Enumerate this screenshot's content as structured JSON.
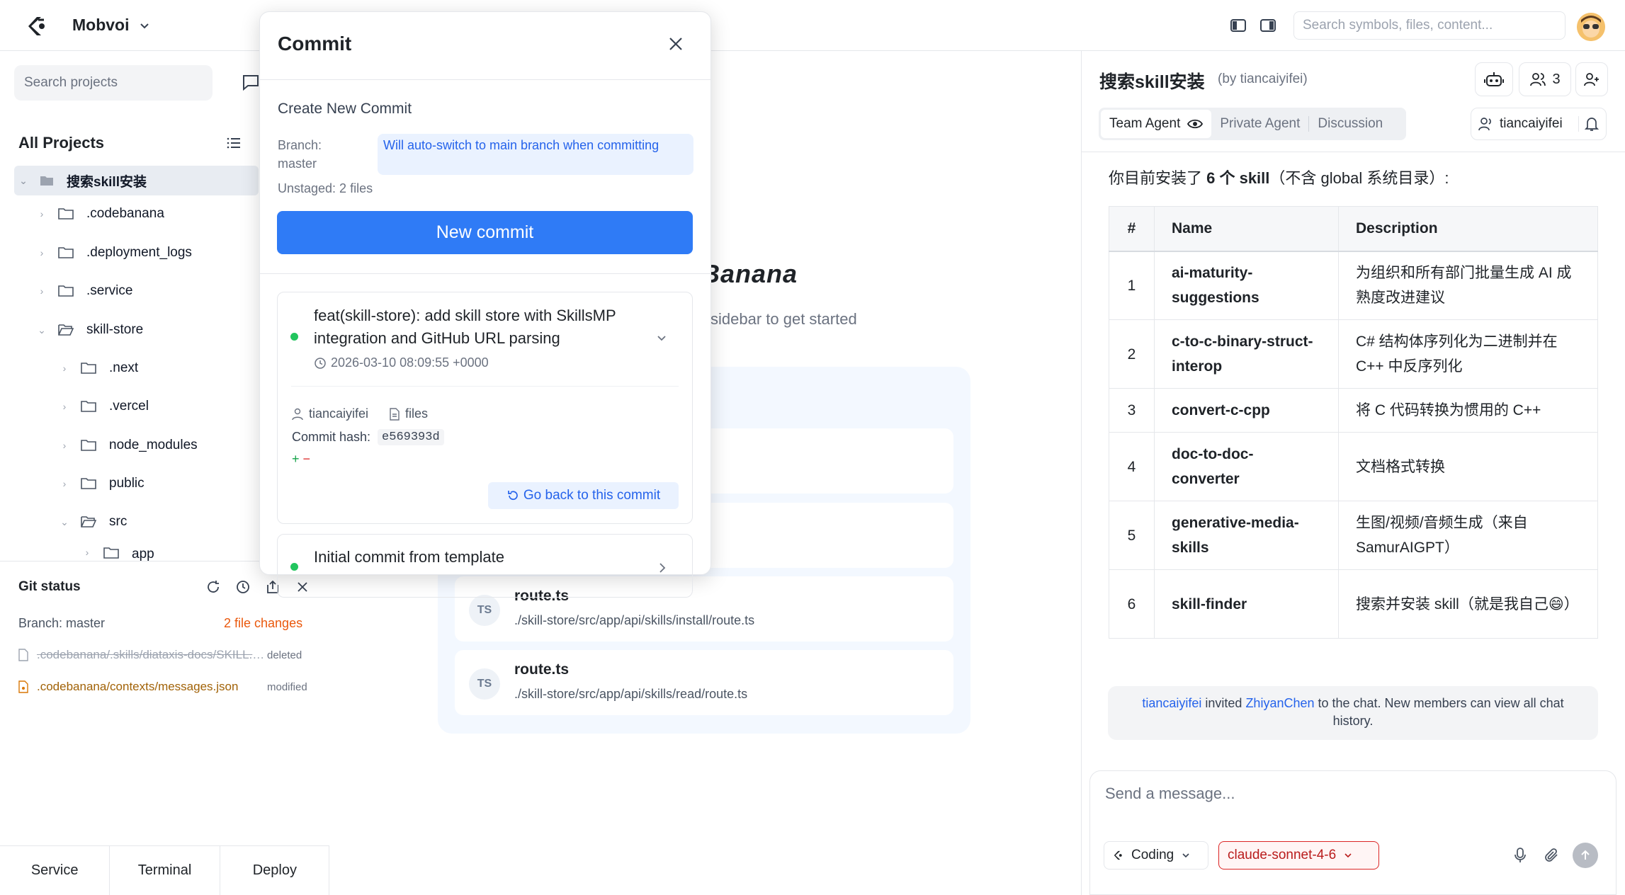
{
  "header": {
    "org_name": "Mobvoi",
    "search_placeholder": "Search symbols, files, content..."
  },
  "sidebar": {
    "search_placeholder": "Search projects",
    "section_title": "All Projects",
    "tree": {
      "root": "搜索skill安装",
      "items": [
        {
          "label": ".codebanana"
        },
        {
          "label": ".deployment_logs"
        },
        {
          "label": ".service"
        },
        {
          "label": "skill-store"
        },
        {
          "label": ".next"
        },
        {
          "label": ".vercel"
        },
        {
          "label": "node_modules"
        },
        {
          "label": "public"
        },
        {
          "label": "src"
        },
        {
          "label": "app"
        }
      ]
    }
  },
  "git_status": {
    "title": "Git status",
    "branch": "Branch: master",
    "changes": "2 file changes",
    "files": [
      {
        "name": ".codebanana/.skills/diataxis-docs/SKILL.md",
        "status": "deleted"
      },
      {
        "name": ".codebanana/contexts/messages.json",
        "status": "modified"
      }
    ]
  },
  "bottom_tabs": [
    "Service",
    "Terminal",
    "Deploy"
  ],
  "welcome": {
    "title_partial": "Banana",
    "subtitle_partial": "sidebar to get started"
  },
  "recent_files": [
    {
      "badge": "TS",
      "name": "route.ts",
      "path": "./skill-store/src/app/api/skills/install/route.ts"
    },
    {
      "badge": "TS",
      "name": "route.ts",
      "path": "./skill-store/src/app/api/skills/read/route.ts"
    }
  ],
  "commit_modal": {
    "title": "Commit",
    "create_label": "Create New Commit",
    "branch_label": "Branch:",
    "branch_name": "master",
    "auto_switch_note": "Will auto-switch to main branch when committing",
    "unstaged": "Unstaged: 2 files",
    "new_commit_button": "New commit",
    "commits": [
      {
        "message": "feat(skill-store): add skill store with SkillsMP integration and GitHub URL parsing",
        "date": "2026-03-10 08:09:55 +0000",
        "author": "tiancaiyifei",
        "files_label": "files",
        "hash_label": "Commit hash:",
        "hash": "e569393d",
        "diff_add": "+",
        "diff_del": "−",
        "go_back_label": "Go back to this commit"
      },
      {
        "message": "Initial commit from template"
      }
    ]
  },
  "chat": {
    "title": "搜索skill安装",
    "by": "(by tiancaiyifei)",
    "member_count": "3",
    "tabs": [
      "Team Agent",
      "Private Agent",
      "Discussion"
    ],
    "user": "tiancaiyifei",
    "intro_prefix": "你目前安装了 ",
    "intro_bold": "6 个 skill",
    "intro_suffix": "（不含 global 系统目录）:",
    "table_headers": [
      "#",
      "Name",
      "Description"
    ],
    "table_rows": [
      {
        "num": "1",
        "name": "ai-maturity-suggestions",
        "desc": "为组织和所有部门批量生成 AI 成熟度改进建议"
      },
      {
        "num": "2",
        "name": "c-to-c-binary-struct-interop",
        "desc": "C# 结构体序列化为二进制并在 C++ 中反序列化"
      },
      {
        "num": "3",
        "name": "convert-c-cpp",
        "desc": "将 C 代码转换为惯用的 C++"
      },
      {
        "num": "4",
        "name": "doc-to-doc-converter",
        "desc": "文档格式转换"
      },
      {
        "num": "5",
        "name": "generative-media-skills",
        "desc": "生图/视频/音频生成（来自 SamurAIGPT）"
      },
      {
        "num": "6",
        "name": "skill-finder",
        "desc": "搜索并安装 skill（就是我自己😄）"
      }
    ],
    "invite": {
      "inviter": "tiancaiyifei",
      "text1": " invited ",
      "invitee": "ZhiyanChen",
      "text2": " to the chat. New members can view all chat history."
    },
    "composer_placeholder": "Send a message...",
    "mode": "Coding",
    "model": "claude-sonnet-4-6"
  },
  "colors": {
    "accent": "#2f7bf6",
    "link": "#2563eb",
    "warning": "#ea580c",
    "danger": "#dc2626",
    "success": "#22c55e"
  }
}
